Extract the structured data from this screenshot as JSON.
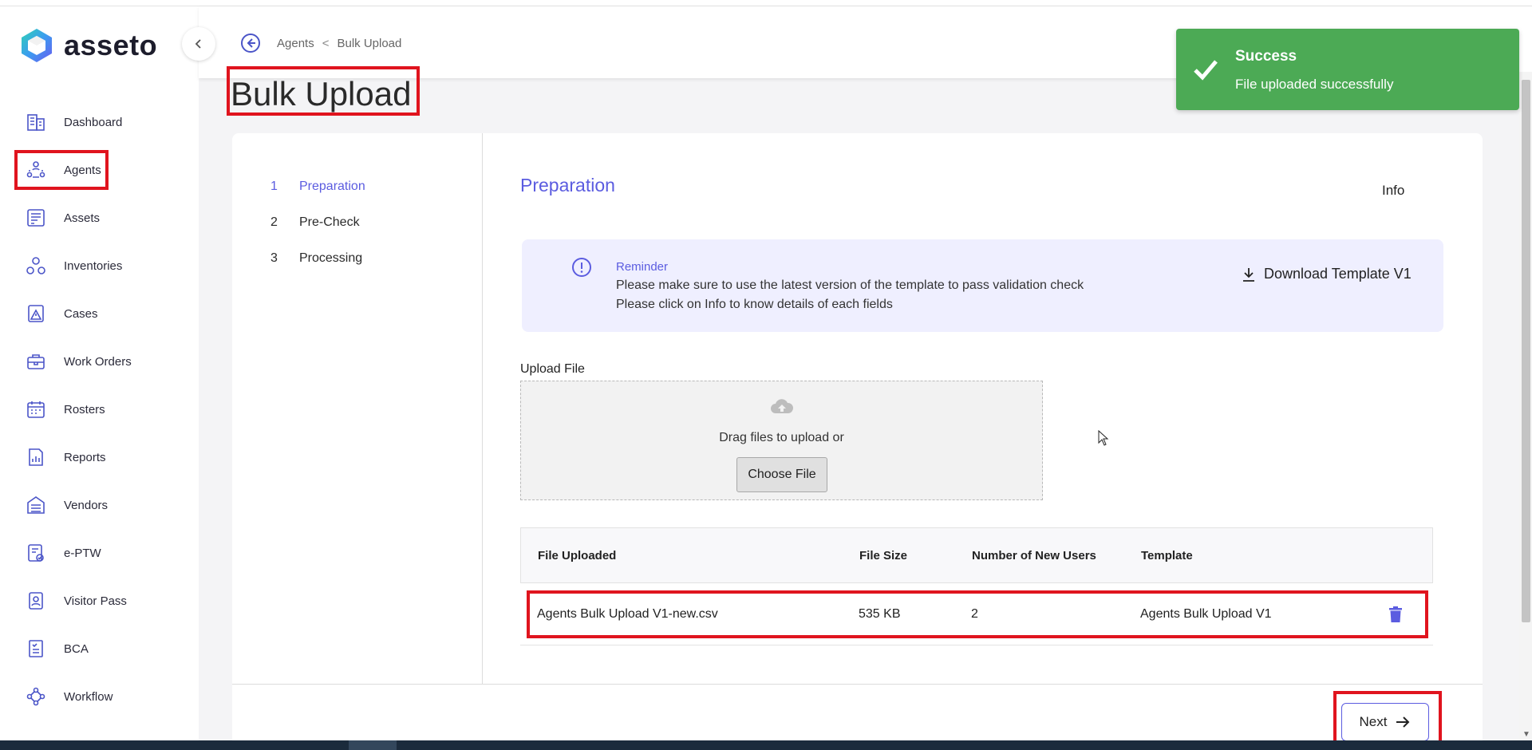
{
  "app": {
    "name": "asseto"
  },
  "sidebar": {
    "items": [
      {
        "label": "Dashboard",
        "icon": "building-icon"
      },
      {
        "label": "Agents",
        "icon": "people-network-icon"
      },
      {
        "label": "Assets",
        "icon": "asset-panel-icon"
      },
      {
        "label": "Inventories",
        "icon": "boxes-icon"
      },
      {
        "label": "Cases",
        "icon": "warning-document-icon"
      },
      {
        "label": "Work Orders",
        "icon": "toolbox-icon"
      },
      {
        "label": "Rosters",
        "icon": "calendar-icon"
      },
      {
        "label": "Reports",
        "icon": "report-chart-icon"
      },
      {
        "label": "Vendors",
        "icon": "vendor-building-icon"
      },
      {
        "label": "e-PTW",
        "icon": "permit-check-icon"
      },
      {
        "label": "Visitor Pass",
        "icon": "visitor-badge-icon"
      },
      {
        "label": "BCA",
        "icon": "bca-document-icon"
      },
      {
        "label": "Workflow",
        "icon": "workflow-icon"
      }
    ]
  },
  "breadcrumb": {
    "parent": "Agents",
    "separator": "<",
    "current": "Bulk Upload"
  },
  "page": {
    "title": "Bulk Upload"
  },
  "steps": [
    {
      "number": "1",
      "label": "Preparation"
    },
    {
      "number": "2",
      "label": "Pre-Check"
    },
    {
      "number": "3",
      "label": "Processing"
    }
  ],
  "section": {
    "title": "Preparation",
    "info_label": "Info"
  },
  "reminder": {
    "title": "Reminder",
    "line1": "Please make sure to use the latest version of the template to pass validation check",
    "line2": "Please click on Info to know details of each fields",
    "download_label": "Download Template V1"
  },
  "upload": {
    "label": "Upload File",
    "drag_text": "Drag files to upload or",
    "choose_label": "Choose File"
  },
  "table": {
    "headers": [
      "File Uploaded",
      "File Size",
      "Number of New Users",
      "Template"
    ],
    "rows": [
      {
        "file": "Agents Bulk Upload V1-new.csv",
        "size": "535 KB",
        "new_users": "2",
        "template": "Agents Bulk Upload V1"
      }
    ]
  },
  "footer": {
    "next_label": "Next"
  },
  "toast": {
    "title": "Success",
    "message": "File uploaded successfully",
    "color": "#4caa55"
  },
  "colors": {
    "accent": "#5b5ce0",
    "highlight": "#e0141e"
  }
}
